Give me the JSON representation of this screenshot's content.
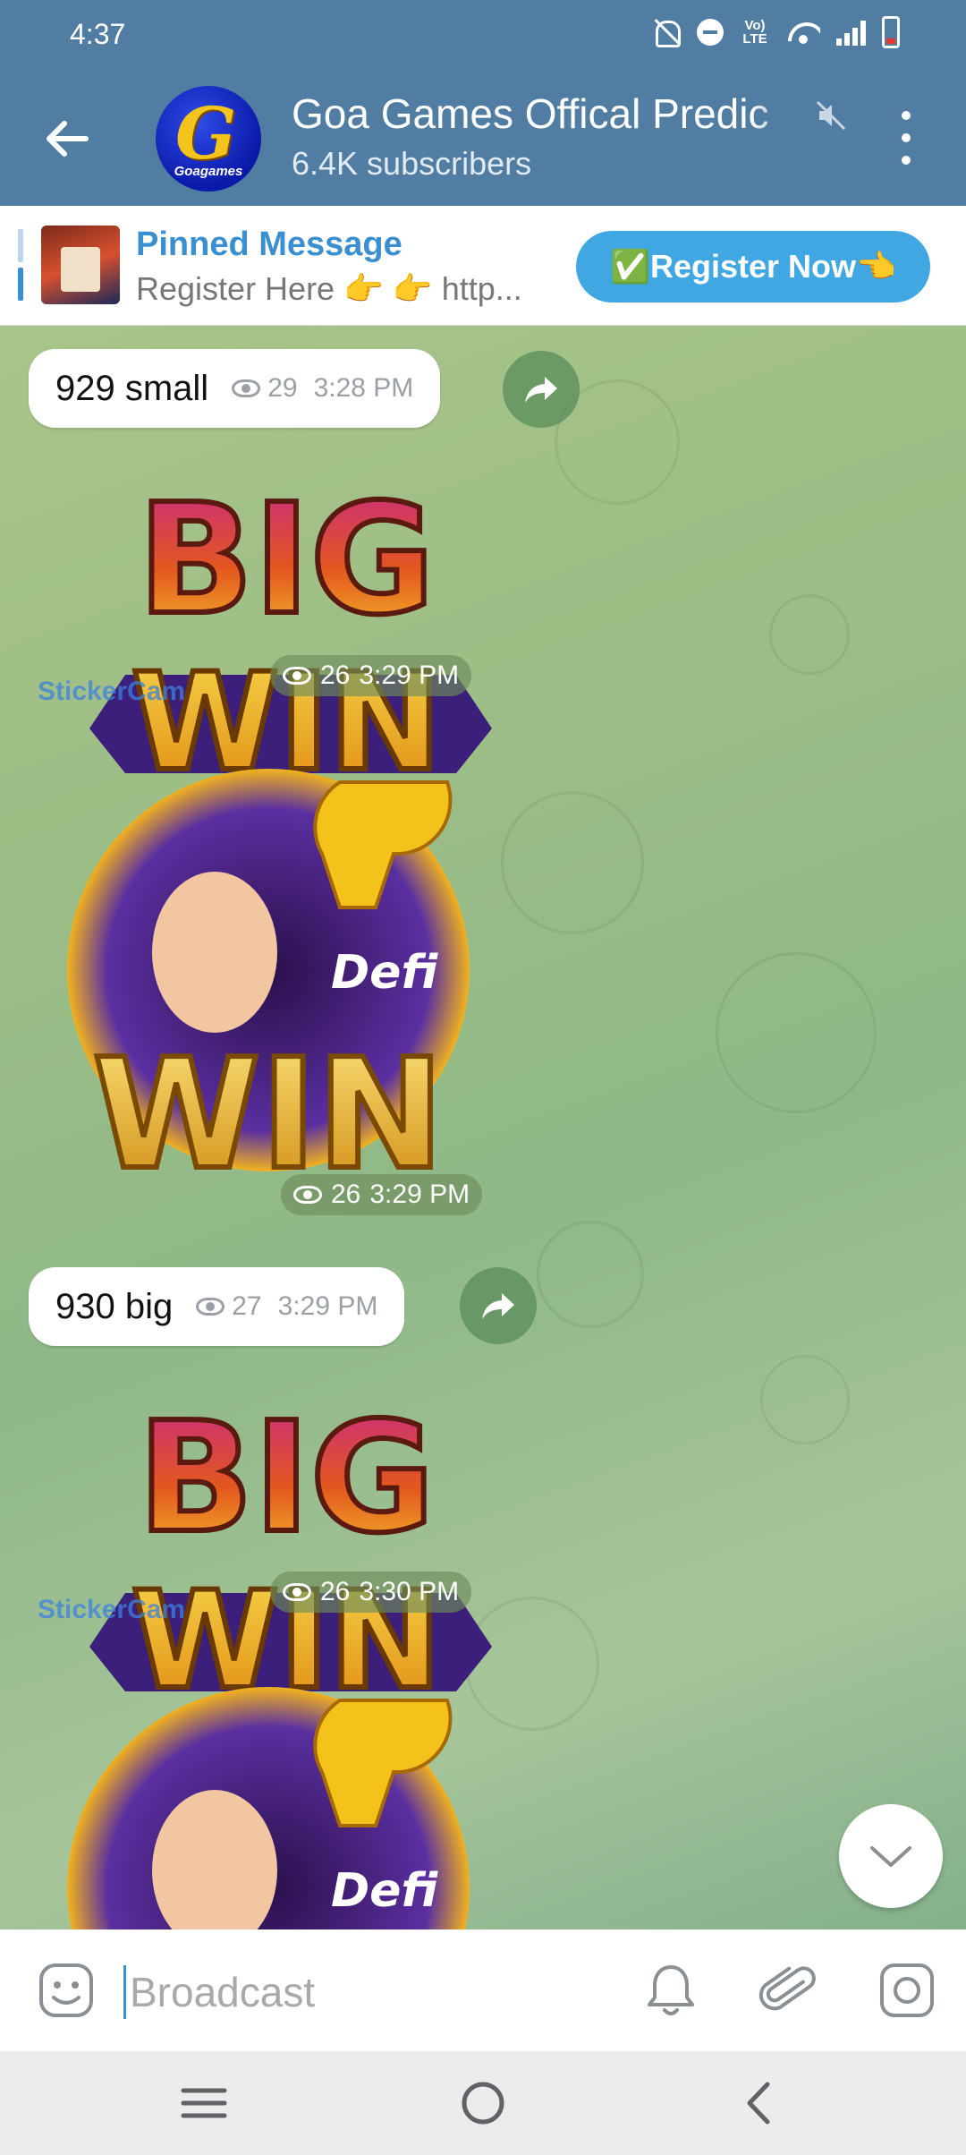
{
  "status": {
    "time": "4:37",
    "volte": "Vo) LTE"
  },
  "header": {
    "channel_title": "Goa Games Offical Predic",
    "subscribers": "6.4K subscribers",
    "avatar_letter": "G",
    "avatar_text": "Goagames"
  },
  "pinned": {
    "title": "Pinned Message",
    "text": "Register Here 👉 👉 http...",
    "button_label": "✅Register Now👈"
  },
  "messages": [
    {
      "text": "929 small",
      "views": "29",
      "time": "3:28 PM"
    },
    {
      "sticker": "BIG WIN",
      "watermark": "StickerCam",
      "views": "26",
      "time": "3:29 PM"
    },
    {
      "sticker": "Defi WIN",
      "views": "26",
      "time": "3:29 PM"
    },
    {
      "text": "930 big",
      "views": "27",
      "time": "3:29 PM"
    },
    {
      "sticker": "BIG WIN",
      "watermark": "StickerCam",
      "views": "26",
      "time": "3:30 PM"
    },
    {
      "sticker": "Defi WIN"
    }
  ],
  "input": {
    "placeholder": "Broadcast"
  },
  "colors": {
    "header": "#517da2",
    "accent": "#40a7e3",
    "pinned_title": "#3a8fd0"
  }
}
